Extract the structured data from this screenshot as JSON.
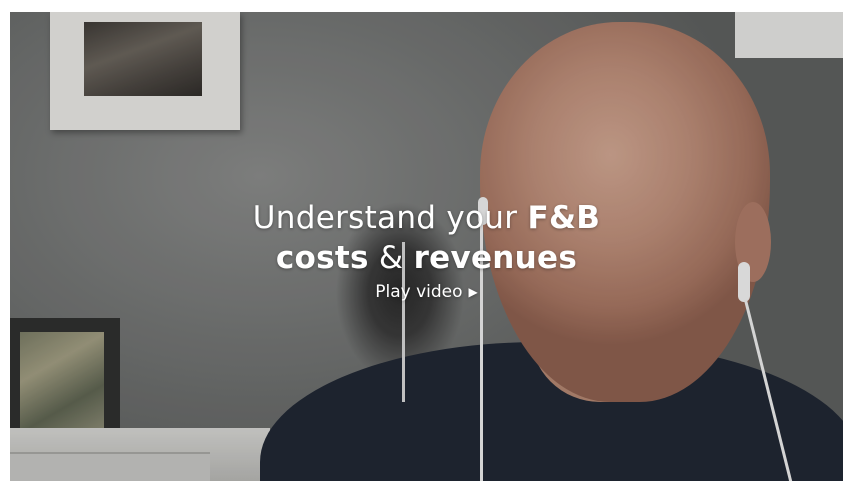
{
  "hero": {
    "line1_light": "Understand your ",
    "line1_bold": "F&B",
    "line2_bold_a": "costs",
    "line2_light": " & ",
    "line2_bold_b": "revenues",
    "play_label": "Play video",
    "play_icon": "play-triangle-icon",
    "play_glyph": "▶"
  },
  "colors": {
    "text": "#ffffff",
    "shirt": "#1f2633"
  }
}
